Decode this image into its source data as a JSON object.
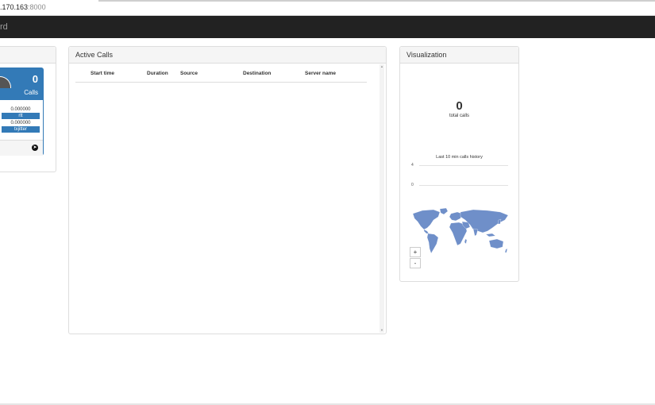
{
  "browser": {
    "url_host": ".170.163",
    "url_port": ":8000"
  },
  "navbar": {
    "brand": "rd"
  },
  "stat_box": {
    "value": "0",
    "label": "Calls",
    "metrics": [
      {
        "value": "0.000000",
        "tag": "rtt"
      },
      {
        "value": "0.000000",
        "tag": "txjitter"
      }
    ],
    "footer_icon": "arrow-circle-right-icon"
  },
  "active_calls": {
    "title": "Active Calls",
    "columns": [
      "Start time",
      "Duration",
      "Source",
      "Destination",
      "Server name"
    ],
    "rows": []
  },
  "visualization": {
    "title": "Visualization",
    "total_calls": "0",
    "total_calls_label": "total calls",
    "history": {
      "title": "Last 10 min calls history",
      "y_ticks": [
        "4",
        "0"
      ]
    },
    "map_color": "#6f8fc9",
    "zoom_in": "+",
    "zoom_out": "-"
  },
  "colors": {
    "accent": "#337ab7",
    "navbar": "#222222"
  }
}
